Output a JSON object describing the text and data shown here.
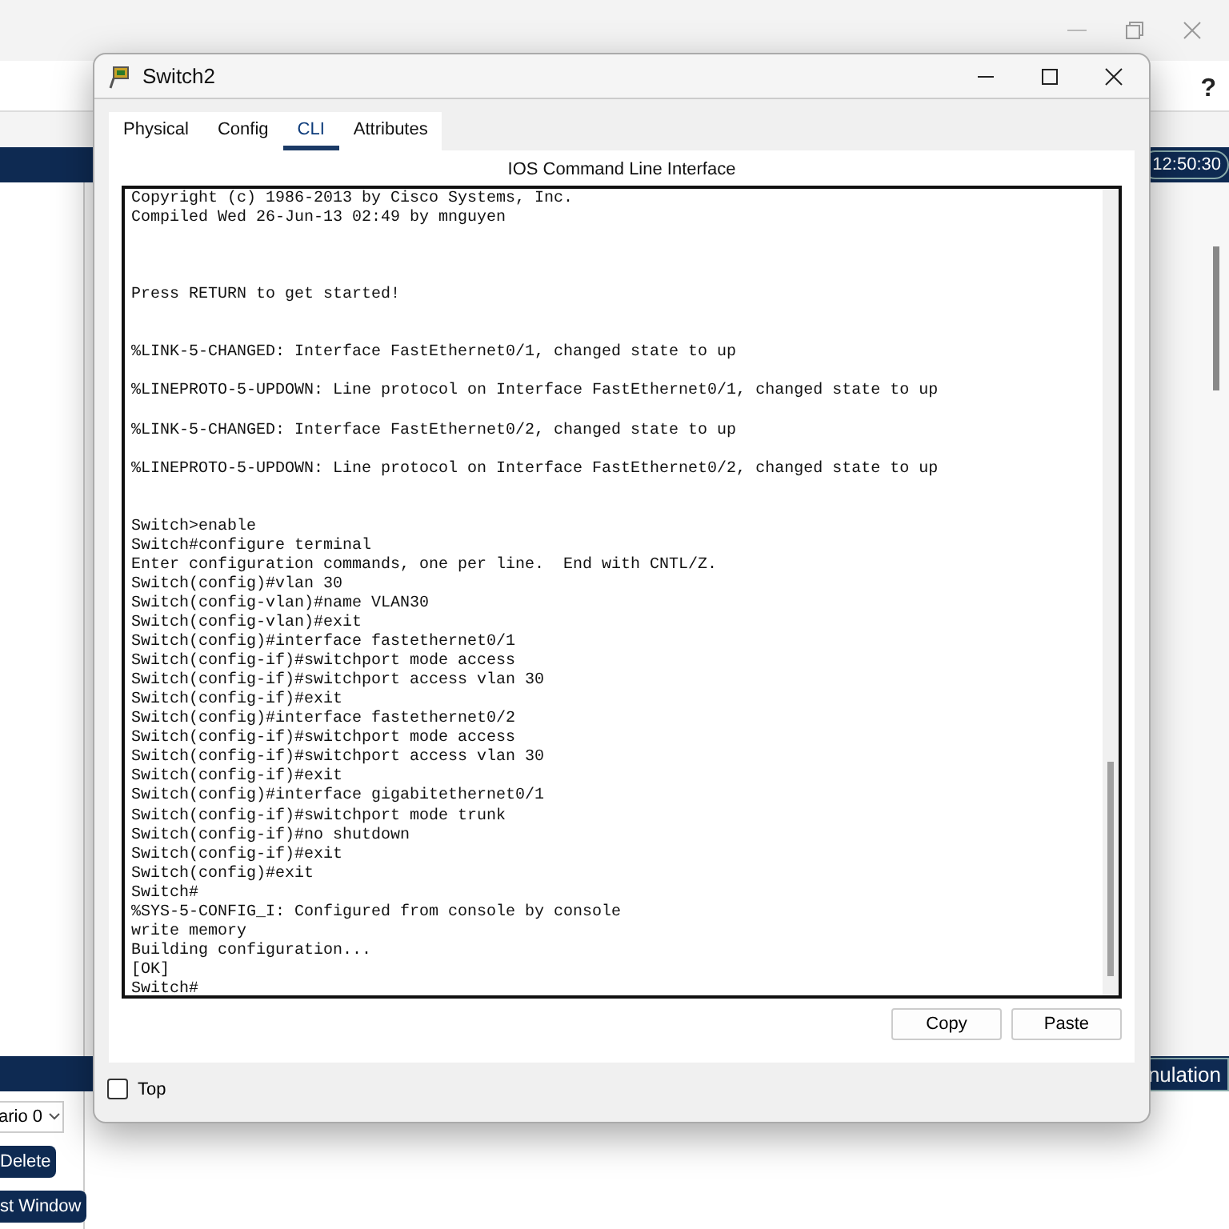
{
  "background": {
    "help": "?",
    "clock": "12:50:30",
    "scenario": "ario 0",
    "delete_button": "Delete",
    "window_button": "st Window",
    "mode_tab": "nulation"
  },
  "window": {
    "title": "Switch2"
  },
  "tabs": [
    {
      "label": "Physical",
      "selected": false
    },
    {
      "label": "Config",
      "selected": false
    },
    {
      "label": "CLI",
      "selected": true
    },
    {
      "label": "Attributes",
      "selected": false
    }
  ],
  "cli": {
    "heading": "IOS Command Line Interface",
    "terminal_text": "Copyright (c) 1986-2013 by Cisco Systems, Inc.\nCompiled Wed 26-Jun-13 02:49 by mnguyen\n\n\n\nPress RETURN to get started!\n\n\n%LINK-5-CHANGED: Interface FastEthernet0/1, changed state to up\n\n%LINEPROTO-5-UPDOWN: Line protocol on Interface FastEthernet0/1, changed state to up\n\n%LINK-5-CHANGED: Interface FastEthernet0/2, changed state to up\n\n%LINEPROTO-5-UPDOWN: Line protocol on Interface FastEthernet0/2, changed state to up\n\n\nSwitch>enable\nSwitch#configure terminal\nEnter configuration commands, one per line.  End with CNTL/Z.\nSwitch(config)#vlan 30\nSwitch(config-vlan)#name VLAN30\nSwitch(config-vlan)#exit\nSwitch(config)#interface fastethernet0/1\nSwitch(config-if)#switchport mode access\nSwitch(config-if)#switchport access vlan 30\nSwitch(config-if)#exit\nSwitch(config)#interface fastethernet0/2\nSwitch(config-if)#switchport mode access\nSwitch(config-if)#switchport access vlan 30\nSwitch(config-if)#exit\nSwitch(config)#interface gigabitethernet0/1\nSwitch(config-if)#switchport mode trunk\nSwitch(config-if)#no shutdown\nSwitch(config-if)#exit\nSwitch(config)#exit\nSwitch#\n%SYS-5-CONFIG_I: Configured from console by console\nwrite memory\nBuilding configuration...\n[OK]\nSwitch#",
    "buttons": [
      "Copy",
      "Paste"
    ]
  },
  "top_checkbox": {
    "label": "Top",
    "checked": false
  }
}
